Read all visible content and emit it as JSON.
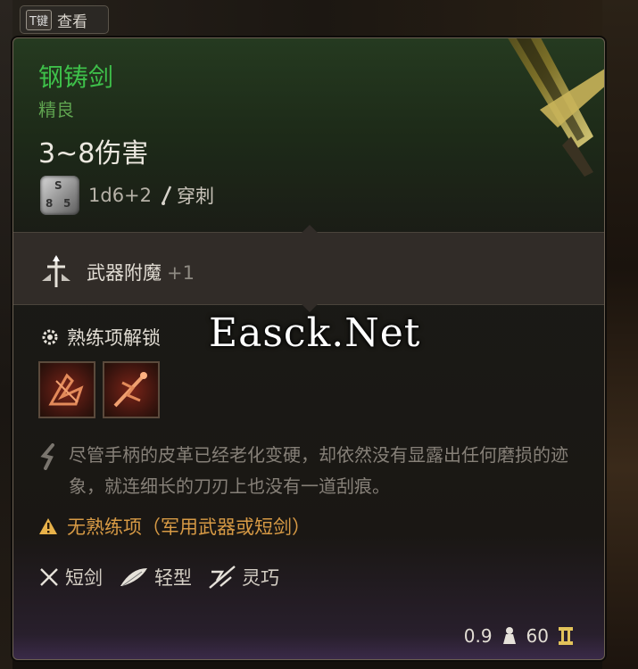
{
  "hint": {
    "key": "T键",
    "label": "查看"
  },
  "item": {
    "name": "钢铸剑",
    "rarity": "精良",
    "damage": "3~8伤害",
    "dice_formula": "1d6+2",
    "damage_type": "穿刺",
    "name_color": "#3ec04a"
  },
  "enchant": {
    "label": "武器附魔",
    "value": "+1"
  },
  "proficiency": {
    "heading": "熟练项解锁",
    "skills": [
      "skill-icon-1",
      "skill-icon-2"
    ]
  },
  "watermark": "Easck.Net",
  "description": "尽管手柄的皮革已经老化变硬，却依然没有显露出任何磨损的迹象，就连细长的刀刃上也没有一道刮痕。",
  "warning": "无熟练项（军用武器或短剑）",
  "tags": [
    {
      "icon": "crossed-swords-icon",
      "label": "短剑"
    },
    {
      "icon": "feather-icon",
      "label": "轻型"
    },
    {
      "icon": "finesse-icon",
      "label": "灵巧"
    }
  ],
  "footer": {
    "weight": "0.9",
    "value": "60"
  }
}
